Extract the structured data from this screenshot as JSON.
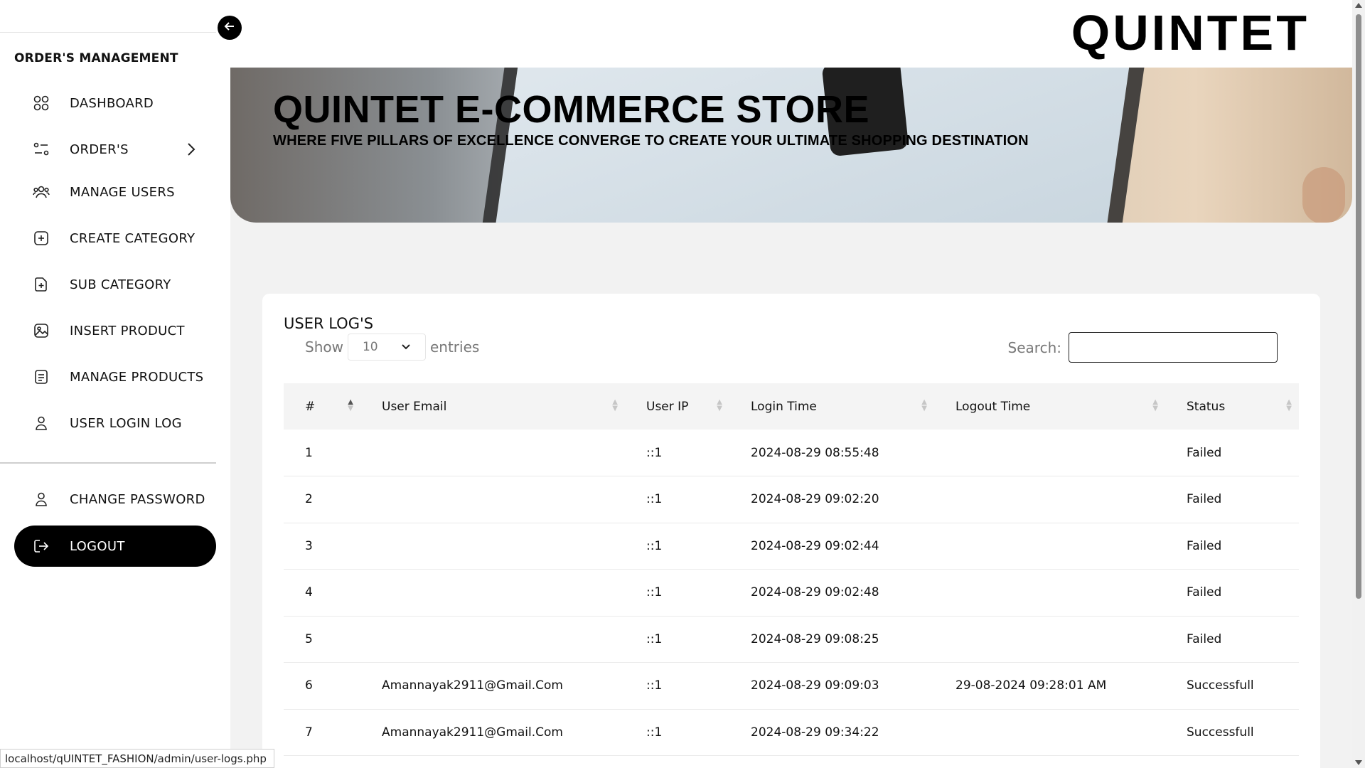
{
  "brand": {
    "name": "QUINTET"
  },
  "sidebar": {
    "section_title": "ORDER'S MANAGEMENT",
    "items": [
      {
        "label": "DASHBOARD",
        "icon": "grid-icon"
      },
      {
        "label": "ORDER'S",
        "icon": "filter-icon"
      },
      {
        "label": "MANAGE USERS",
        "icon": "users-icon"
      },
      {
        "label": "CREATE CATEGORY",
        "icon": "plus-square-icon"
      },
      {
        "label": "SUB CATEGORY",
        "icon": "file-plus-icon"
      },
      {
        "label": "INSERT PRODUCT",
        "icon": "image-icon"
      },
      {
        "label": "MANAGE PRODUCTS",
        "icon": "document-icon"
      },
      {
        "label": "USER LOGIN LOG",
        "icon": "user-icon"
      }
    ],
    "change_password": "CHANGE PASSWORD",
    "logout": "LOGOUT"
  },
  "banner": {
    "title": "QUINTET E-COMMERCE STORE",
    "subtitle": "WHERE FIVE PILLARS OF EXCELLENCE CONVERGE TO CREATE YOUR ULTIMATE SHOPPING DESTINATION"
  },
  "logs": {
    "title": "USER LOG'S",
    "show_label": "Show",
    "entries_value": "10",
    "entries_label": "entries",
    "search_label": "Search:",
    "search_value": "",
    "columns": [
      "#",
      "User Email",
      "User IP",
      "Login Time",
      "Logout Time",
      "Status"
    ],
    "rows": [
      {
        "num": "1",
        "email": "",
        "ip": "::1",
        "login": "2024-08-29 08:55:48",
        "logout": "",
        "status": "Failed"
      },
      {
        "num": "2",
        "email": "",
        "ip": "::1",
        "login": "2024-08-29 09:02:20",
        "logout": "",
        "status": "Failed"
      },
      {
        "num": "3",
        "email": "",
        "ip": "::1",
        "login": "2024-08-29 09:02:44",
        "logout": "",
        "status": "Failed"
      },
      {
        "num": "4",
        "email": "",
        "ip": "::1",
        "login": "2024-08-29 09:02:48",
        "logout": "",
        "status": "Failed"
      },
      {
        "num": "5",
        "email": "",
        "ip": "::1",
        "login": "2024-08-29 09:08:25",
        "logout": "",
        "status": "Failed"
      },
      {
        "num": "6",
        "email": "Amannayak2911@Gmail.Com",
        "ip": "::1",
        "login": "2024-08-29 09:09:03",
        "logout": "29-08-2024 09:28:01 AM",
        "status": "Successfull"
      },
      {
        "num": "7",
        "email": "Amannayak2911@Gmail.Com",
        "ip": "::1",
        "login": "2024-08-29 09:34:22",
        "logout": "",
        "status": "Successfull"
      }
    ]
  },
  "statusbar": {
    "url": "localhost/qUINTET_FASHION/admin/user-logs.php"
  }
}
